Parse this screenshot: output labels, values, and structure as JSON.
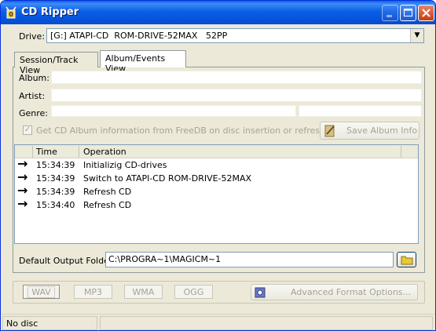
{
  "window": {
    "title": "CD Ripper"
  },
  "drive": {
    "label": "Drive:",
    "selected": "[G:] ATAPI-CD  ROM-DRIVE-52MAX   52PP"
  },
  "tabs": [
    {
      "label": "Session/Track View",
      "active": false
    },
    {
      "label": "Album/Events View",
      "active": true
    }
  ],
  "album": {
    "album_label": "Album:",
    "album_value": "",
    "artist_label": "Artist:",
    "artist_value": "",
    "genre_label": "Genre:",
    "genre_value": "",
    "genre_extra_value": ""
  },
  "freedb": {
    "checkbox_checked": true,
    "checkbox_label": "Get CD Album information from FreeDB on disc insertion or refreshing",
    "save_button": "Save Album Info"
  },
  "log": {
    "columns": [
      "Time",
      "Operation"
    ],
    "rows": [
      {
        "time": "15:34:39",
        "operation": "Initializig CD-drives"
      },
      {
        "time": "15:34:39",
        "operation": "Switch to ATAPI-CD ROM-DRIVE-52MAX"
      },
      {
        "time": "15:34:39",
        "operation": "Refresh CD"
      },
      {
        "time": "15:34:40",
        "operation": "Refresh CD"
      }
    ]
  },
  "output": {
    "label": "Default Output Folder",
    "path": "C:\\PROGRA~1\\MAGICM~1"
  },
  "formats": {
    "wav": "WAV",
    "mp3": "MP3",
    "wma": "WMA",
    "ogg": "OGG",
    "advanced": "Advanced Format Options..."
  },
  "status": {
    "text": "No disc",
    "text2": ""
  },
  "colors": {
    "titlebar": "#0a5fe6",
    "face": "#ece9d8",
    "disabled_text": "#a5a397"
  }
}
